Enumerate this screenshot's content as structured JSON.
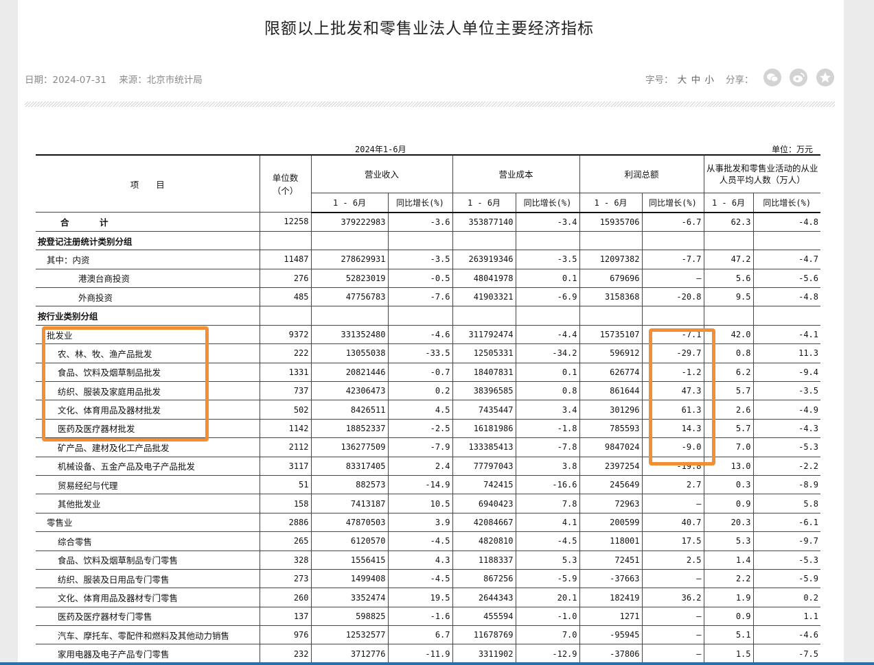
{
  "page": {
    "title": "限额以上批发和零售业法人单位主要经济指标",
    "date": "日期：2024-07-31",
    "source": "来源：北京市统计局",
    "font_size_label": "字号：",
    "font_sizes": [
      "大",
      "中",
      "小"
    ],
    "share_label": "分享："
  },
  "table": {
    "period_caption": "2024年1-6月",
    "unit_caption": "单位：万元",
    "headers": {
      "item": "项　　目",
      "units": "单位数（个）",
      "revenue": "营业收入",
      "cost": "营业成本",
      "profit": "利润总额",
      "employees": "从事批发和零售业活动的从业人员平均人数（万人）",
      "period": "1 - 6月",
      "yoy": "同比增长(%)"
    },
    "rows": [
      {
        "name": "合　计",
        "level": 0,
        "units": "12258",
        "rev": "379222983",
        "rev_g": "-3.6",
        "cost": "353877140",
        "cost_g": "-3.4",
        "profit": "15935706",
        "profit_g": "-6.7",
        "emp": "62.3",
        "emp_g": "-4.8"
      },
      {
        "name": "按登记注册统计类别分组",
        "level": 1,
        "units": "",
        "rev": "",
        "rev_g": "",
        "cost": "",
        "cost_g": "",
        "profit": "",
        "profit_g": "",
        "emp": "",
        "emp_g": ""
      },
      {
        "name": "其中：内资",
        "level": 2,
        "units": "11487",
        "rev": "278629931",
        "rev_g": "-3.5",
        "cost": "263919346",
        "cost_g": "-3.5",
        "profit": "12097382",
        "profit_g": "-7.7",
        "emp": "47.2",
        "emp_g": "-4.7"
      },
      {
        "name": "港澳台商投资",
        "level": 3,
        "units": "276",
        "rev": "52823019",
        "rev_g": "-0.5",
        "cost": "48041978",
        "cost_g": "0.1",
        "profit": "679696",
        "profit_g": "—",
        "emp": "5.6",
        "emp_g": "-5.6"
      },
      {
        "name": "外商投资",
        "level": 3,
        "units": "485",
        "rev": "47756783",
        "rev_g": "-7.6",
        "cost": "41903321",
        "cost_g": "-6.9",
        "profit": "3158368",
        "profit_g": "-20.8",
        "emp": "9.5",
        "emp_g": "-4.8"
      },
      {
        "name": "按行业类别分组",
        "level": 1,
        "units": "",
        "rev": "",
        "rev_g": "",
        "cost": "",
        "cost_g": "",
        "profit": "",
        "profit_g": "",
        "emp": "",
        "emp_g": ""
      },
      {
        "name": "批发业",
        "level": 2,
        "units": "9372",
        "rev": "331352480",
        "rev_g": "-4.6",
        "cost": "311792474",
        "cost_g": "-4.4",
        "profit": "15735107",
        "profit_g": "-7.1",
        "emp": "42.0",
        "emp_g": "-4.1"
      },
      {
        "name": "农、林、牧、渔产品批发",
        "level": 4,
        "units": "222",
        "rev": "13055038",
        "rev_g": "-33.5",
        "cost": "12505331",
        "cost_g": "-34.2",
        "profit": "596912",
        "profit_g": "-29.7",
        "emp": "0.8",
        "emp_g": "11.3"
      },
      {
        "name": "食品、饮料及烟草制品批发",
        "level": 4,
        "units": "1331",
        "rev": "20821446",
        "rev_g": "-0.7",
        "cost": "18407831",
        "cost_g": "0.1",
        "profit": "626774",
        "profit_g": "-1.2",
        "emp": "6.2",
        "emp_g": "-9.4"
      },
      {
        "name": "纺织、服装及家庭用品批发",
        "level": 4,
        "units": "737",
        "rev": "42306473",
        "rev_g": "0.2",
        "cost": "38396585",
        "cost_g": "0.8",
        "profit": "861644",
        "profit_g": "47.3",
        "emp": "5.7",
        "emp_g": "-3.5"
      },
      {
        "name": "文化、体育用品及器材批发",
        "level": 4,
        "units": "502",
        "rev": "8426511",
        "rev_g": "4.5",
        "cost": "7435447",
        "cost_g": "3.4",
        "profit": "301296",
        "profit_g": "61.3",
        "emp": "2.6",
        "emp_g": "-4.9"
      },
      {
        "name": "医药及医疗器材批发",
        "level": 4,
        "units": "1142",
        "rev": "18852337",
        "rev_g": "-2.5",
        "cost": "16181986",
        "cost_g": "-1.8",
        "profit": "785593",
        "profit_g": "14.3",
        "emp": "5.7",
        "emp_g": "-4.3"
      },
      {
        "name": "矿产品、建材及化工产品批发",
        "level": 4,
        "units": "2112",
        "rev": "136277509",
        "rev_g": "-7.9",
        "cost": "133385413",
        "cost_g": "-7.8",
        "profit": "9847024",
        "profit_g": "-9.0",
        "emp": "7.0",
        "emp_g": "-5.3"
      },
      {
        "name": "机械设备、五金产品及电子产品批发",
        "level": 4,
        "units": "3117",
        "rev": "83317405",
        "rev_g": "2.4",
        "cost": "77797043",
        "cost_g": "3.8",
        "profit": "2397254",
        "profit_g": "-19.8",
        "emp": "13.0",
        "emp_g": "-2.2"
      },
      {
        "name": "贸易经纪与代理",
        "level": 4,
        "units": "51",
        "rev": "882573",
        "rev_g": "-14.9",
        "cost": "742415",
        "cost_g": "-16.6",
        "profit": "245649",
        "profit_g": "2.7",
        "emp": "0.3",
        "emp_g": "-8.9"
      },
      {
        "name": "其他批发业",
        "level": 4,
        "units": "158",
        "rev": "7413187",
        "rev_g": "10.5",
        "cost": "6940423",
        "cost_g": "7.8",
        "profit": "72963",
        "profit_g": "—",
        "emp": "0.9",
        "emp_g": "5.8"
      },
      {
        "name": "零售业",
        "level": 2,
        "units": "2886",
        "rev": "47870503",
        "rev_g": "3.9",
        "cost": "42084667",
        "cost_g": "4.1",
        "profit": "200599",
        "profit_g": "40.7",
        "emp": "20.3",
        "emp_g": "-6.1"
      },
      {
        "name": "综合零售",
        "level": 4,
        "units": "265",
        "rev": "6120570",
        "rev_g": "-4.5",
        "cost": "4820810",
        "cost_g": "-4.5",
        "profit": "118001",
        "profit_g": "17.5",
        "emp": "5.3",
        "emp_g": "-9.7"
      },
      {
        "name": "食品、饮料及烟草制品专门零售",
        "level": 4,
        "units": "328",
        "rev": "1556415",
        "rev_g": "4.3",
        "cost": "1188337",
        "cost_g": "5.3",
        "profit": "72451",
        "profit_g": "2.5",
        "emp": "1.4",
        "emp_g": "-5.3"
      },
      {
        "name": "纺织、服装及日用品专门零售",
        "level": 4,
        "units": "273",
        "rev": "1499408",
        "rev_g": "-4.5",
        "cost": "867256",
        "cost_g": "-5.9",
        "profit": "-37663",
        "profit_g": "—",
        "emp": "2.2",
        "emp_g": "-5.9"
      },
      {
        "name": "文化、体育用品及器材专门零售",
        "level": 4,
        "units": "260",
        "rev": "3352474",
        "rev_g": "19.5",
        "cost": "2644343",
        "cost_g": "20.1",
        "profit": "182419",
        "profit_g": "36.2",
        "emp": "1.9",
        "emp_g": "0.2"
      },
      {
        "name": "医药及医疗器材专门零售",
        "level": 4,
        "units": "137",
        "rev": "598825",
        "rev_g": "-1.6",
        "cost": "455594",
        "cost_g": "-1.0",
        "profit": "1271",
        "profit_g": "—",
        "emp": "0.9",
        "emp_g": "1.1"
      },
      {
        "name": "汽车、摩托车、零配件和燃料及其他动力销售",
        "level": 4,
        "units": "976",
        "rev": "12532577",
        "rev_g": "6.7",
        "cost": "11678769",
        "cost_g": "7.0",
        "profit": "-95945",
        "profit_g": "—",
        "emp": "5.1",
        "emp_g": "-4.6"
      },
      {
        "name": "家用电器及电子产品专门零售",
        "level": 4,
        "units": "232",
        "rev": "3712776",
        "rev_g": "-11.9",
        "cost": "3311902",
        "cost_g": "-12.9",
        "profit": "-37806",
        "profit_g": "—",
        "emp": "1.5",
        "emp_g": "-7.5"
      }
    ]
  },
  "annotations": {
    "highlight_color": "#f28f35",
    "accent_color": "#2d6ea9"
  },
  "icons": {
    "wechat": "wechat-icon",
    "weibo": "weibo-icon",
    "favorite": "star-icon"
  }
}
